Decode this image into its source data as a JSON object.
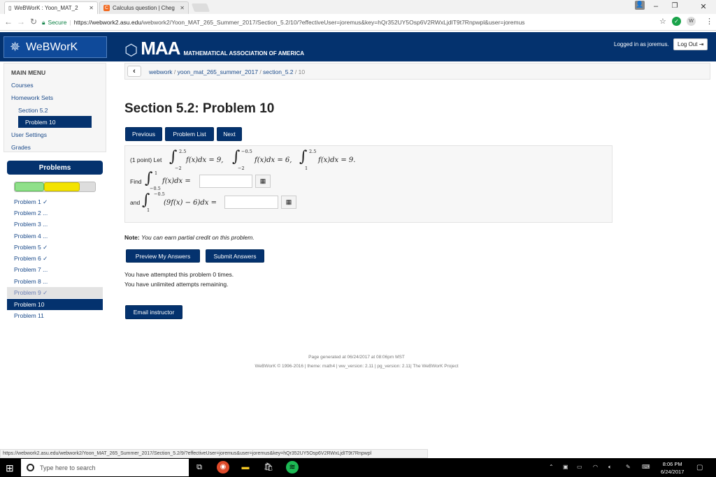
{
  "browser": {
    "tabs": [
      {
        "label": "WeBWorK : Yoon_MAT_2"
      },
      {
        "label": "Calculus question | Cheg"
      }
    ],
    "secure_label": "Secure",
    "url_host": "https://webwork2.asu.edu",
    "url_path": "/webwork2/Yoon_MAT_265_Summer_2017/Section_5.2/10/?effectiveUser=joremus&key=hQr352UY5Osp6V2RWxLjdIT9t7Rnpwpl&user=joremus",
    "status_url": "https://webwork2.asu.edu/webwork2/Yoon_MAT_265_Summer_2017/Section_5.2/9/?effectiveUser=joremus&user=joremus&key=hQr352UY5Osp6V2RWxLjdIT9t7Rnpwpl",
    "ext_label": "W"
  },
  "header": {
    "brand": "WeBWorK",
    "maa_logo": "MAA",
    "maa_sub": "MATHEMATICAL ASSOCIATION OF AMERICA",
    "logged_in": "Logged in as joremus.",
    "logout": "Log Out"
  },
  "sidebar": {
    "main_menu": "MAIN MENU",
    "courses": "Courses",
    "homework_sets": "Homework Sets",
    "section": "Section 5.2",
    "problem": "Problem 10",
    "user_settings": "User Settings",
    "grades": "Grades",
    "problems_header": "Problems",
    "progress": {
      "correct_fraction": 0.36,
      "partial_fraction": 0.44
    },
    "problems": [
      {
        "label": "Problem 1 ✓"
      },
      {
        "label": "Problem 2 ..."
      },
      {
        "label": "Problem 3 ..."
      },
      {
        "label": "Problem 4 ..."
      },
      {
        "label": "Problem 5 ✓"
      },
      {
        "label": "Problem 6 ✓"
      },
      {
        "label": "Problem 7 ..."
      },
      {
        "label": "Problem 8 ..."
      },
      {
        "label": "Problem 9 ✓"
      },
      {
        "label": "Problem 10"
      },
      {
        "label": "Problem 11"
      }
    ]
  },
  "breadcrumb": {
    "root": "webwork",
    "course": "yoon_mat_265_summer_2017",
    "set": "section_5.2",
    "problem": "10"
  },
  "main": {
    "title": "Section 5.2: Problem 10",
    "btn_previous": "Previous",
    "btn_list": "Problem List",
    "btn_next": "Next",
    "problem": {
      "intro": "(1 point) Let",
      "i1_upper": "2.5",
      "i1_lower": "−2",
      "i1_expr": "f(x)dx = 9,",
      "i2_upper": "−0.5",
      "i2_lower": "−2",
      "i2_expr": "f(x)dx = 6,",
      "i3_upper": "2.5",
      "i3_lower": "1",
      "i3_expr": "f(x)dx = 9.",
      "find": "Find",
      "f_upper": "1",
      "f_lower": "−0.5",
      "f_expr": "f(x)dx =",
      "and": "and",
      "a_upper": "−0.5",
      "a_lower": "1",
      "a_expr": "(9f(x) − 6)dx =",
      "answer1": "",
      "answer2": ""
    },
    "note_label": "Note:",
    "note_text": "You can earn partial credit on this problem.",
    "btn_preview": "Preview My Answers",
    "btn_submit": "Submit Answers",
    "attempted": "You have attempted this problem 0 times.",
    "remaining": "You have unlimited attempts remaining.",
    "btn_email": "Email instructor"
  },
  "footer": {
    "generated": "Page generated at 06/24/2017 at 08:06pm MST",
    "credits": "WeBWorK © 1996-2016 | theme: math4 | ww_version: 2.11 | pg_version: 2.11| The WeBWorK Project"
  },
  "taskbar": {
    "search_placeholder": "Type here to search",
    "time": "8:06 PM",
    "date": "6/24/2017"
  }
}
